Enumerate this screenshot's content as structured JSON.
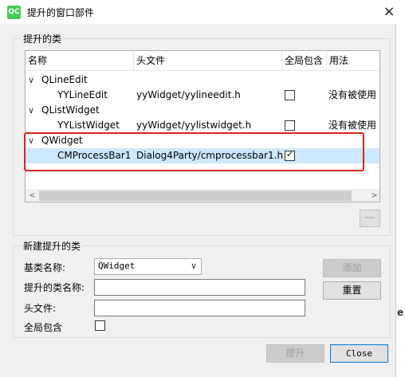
{
  "window": {
    "app_icon": "QC",
    "title": "提升的窗口部件",
    "close": "×"
  },
  "promoted_group": {
    "title": "提升的类",
    "columns": [
      "名称",
      "头文件",
      "全局包含",
      "用法"
    ],
    "rows": [
      {
        "level": 0,
        "expanded": true,
        "name": "QLineEdit",
        "header": "",
        "global_include": null,
        "usage": "",
        "selected": false
      },
      {
        "level": 1,
        "name": "YYLineEdit",
        "header": "yyWidget/yylineedit.h",
        "global_include": false,
        "usage": "没有被使用",
        "selected": false
      },
      {
        "level": 0,
        "expanded": true,
        "name": "QListWidget",
        "header": "",
        "global_include": null,
        "usage": "",
        "selected": false
      },
      {
        "level": 1,
        "name": "YYListWidget",
        "header": "yyWidget/yylistwidget.h",
        "global_include": false,
        "usage": "没有被使用",
        "selected": false
      },
      {
        "level": 0,
        "expanded": true,
        "name": "QWidget",
        "header": "",
        "global_include": null,
        "usage": "",
        "selected": false
      },
      {
        "level": 1,
        "name": "CMProcessBar1",
        "header": "Dialog4Party/cmprocessbar1.h",
        "global_include": true,
        "usage": "",
        "selected": true
      }
    ],
    "scroll_left": "<",
    "scroll_right": ">",
    "remove_button": "—"
  },
  "new_group": {
    "title": "新建提升的类",
    "base_class_label": "基类名称:",
    "base_class_value": "QWidget",
    "promoted_class_label": "提升的类名称:",
    "promoted_class_value": "",
    "header_file_label": "头文件:",
    "header_file_value": "",
    "global_include_label": "全局包含",
    "global_include_checked": false,
    "add_button": "添加",
    "reset_button": "重置"
  },
  "footer": {
    "promote_button": "提升",
    "close_button": "Close"
  },
  "edge_char": "e",
  "colors": {
    "highlight_box": "#e0201c",
    "selection": "#cce8ff",
    "qt_green": "#41cd52"
  }
}
